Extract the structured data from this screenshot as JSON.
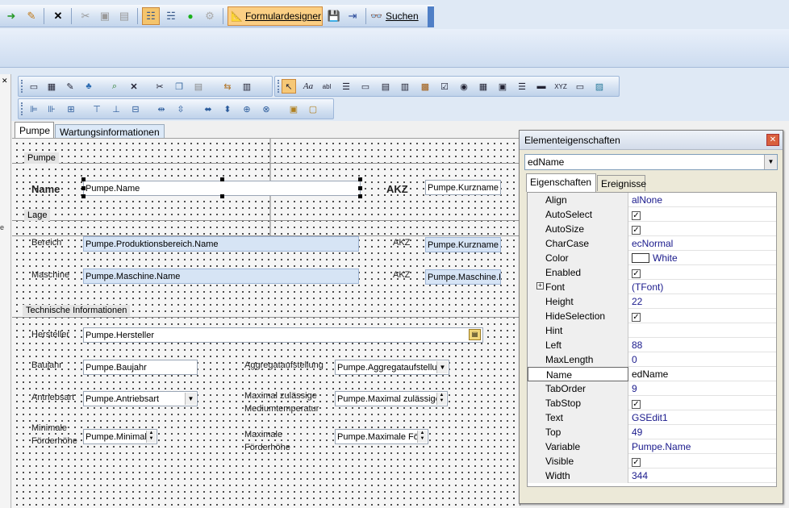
{
  "top_toolbar": {
    "designer_label": "Formulardesigner",
    "search_label": "Suchen"
  },
  "tabs": [
    "Pumpe",
    "Wartungsinformationen"
  ],
  "form": {
    "groups": {
      "pumpe": "Pumpe",
      "lage": "Lage",
      "technik": "Technische Informationen"
    },
    "labels": {
      "name": "Name",
      "akz1": "AKZ",
      "bereich": "Bereich",
      "akz2": "AKZ",
      "maschine": "Maschine",
      "akz3": "AKZ",
      "hersteller": "Hersteller",
      "baujahr": "Baujahr",
      "aggregat": "Aggregataufstellung",
      "antriebsart": "Antriebsart",
      "max_temp_1": "Maximal zulässige",
      "max_temp_2": "Mediumtemperatur",
      "min_foerder_1": "Minimale",
      "min_foerder_2": "Förderhöhe",
      "max_foerder_1": "Maximale",
      "max_foerder_2": "Förderhöhe"
    },
    "fields": {
      "name": "Pumpe.Name",
      "kurzname1": "Pumpe.Kurzname",
      "bereich": "Pumpe.Produktionsbereich.Name",
      "kurzname2": "Pumpe.Kurzname",
      "maschine": "Pumpe.Maschine.Name",
      "maschine_k": "Pumpe.Maschine.K",
      "hersteller": "Pumpe.Hersteller",
      "baujahr": "Pumpe.Baujahr",
      "aggregat": "Pumpe.Aggregataufstellu",
      "antriebsart": "Pumpe.Antriebsart",
      "max_temp": "Pumpe.Maximal zulässige",
      "min_foerder": "Pumpe.Minimale",
      "max_foerder": "Pumpe.Maximale För"
    }
  },
  "properties": {
    "title": "Elementeigenschaften",
    "selected_component": "edName",
    "tab_properties": "Eigenschaften",
    "tab_events": "Ereignisse",
    "rows": [
      {
        "name": "Align",
        "value": "alNone"
      },
      {
        "name": "AutoSelect",
        "value": "✓",
        "check": true
      },
      {
        "name": "AutoSize",
        "value": "✓",
        "check": true
      },
      {
        "name": "CharCase",
        "value": "ecNormal"
      },
      {
        "name": "Color",
        "value": "White",
        "swatch": true
      },
      {
        "name": "Enabled",
        "value": "✓",
        "check": true
      },
      {
        "name": "Font",
        "value": "(TFont)",
        "expand": true
      },
      {
        "name": "Height",
        "value": "22"
      },
      {
        "name": "HideSelection",
        "value": "✓",
        "check": true
      },
      {
        "name": "Hint",
        "value": ""
      },
      {
        "name": "Left",
        "value": "88"
      },
      {
        "name": "MaxLength",
        "value": "0"
      },
      {
        "name": "Name",
        "value": "edName",
        "selected": true
      },
      {
        "name": "TabOrder",
        "value": "9"
      },
      {
        "name": "TabStop",
        "value": "✓",
        "check": true
      },
      {
        "name": "Text",
        "value": "GSEdit1"
      },
      {
        "name": "Top",
        "value": "49"
      },
      {
        "name": "Variable",
        "value": "Pumpe.Name"
      },
      {
        "name": "Visible",
        "value": "✓",
        "check": true
      },
      {
        "name": "Width",
        "value": "344"
      }
    ]
  }
}
